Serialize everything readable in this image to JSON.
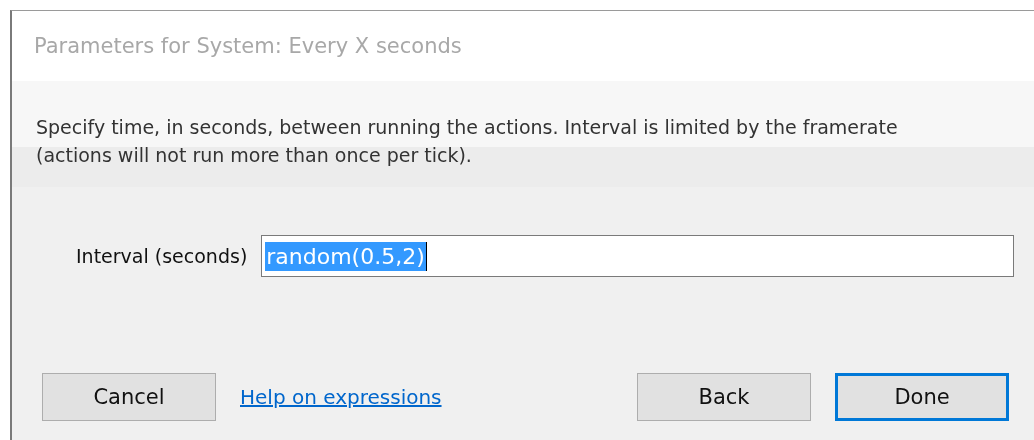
{
  "window": {
    "title": "Parameters for System: Every X seconds"
  },
  "description": "Specify time, in seconds, between running the actions.  Interval is limited by the framerate (actions will not run more than once per tick).",
  "field": {
    "label": "Interval (seconds)",
    "value": "random(0.5,2)",
    "value_selected": true
  },
  "buttons_left": [
    {
      "label": "Cancel",
      "default": false
    }
  ],
  "help_link": "Help on expressions",
  "buttons_right": [
    {
      "label": "Back",
      "default": false
    },
    {
      "label": "Done",
      "default": true
    }
  ]
}
